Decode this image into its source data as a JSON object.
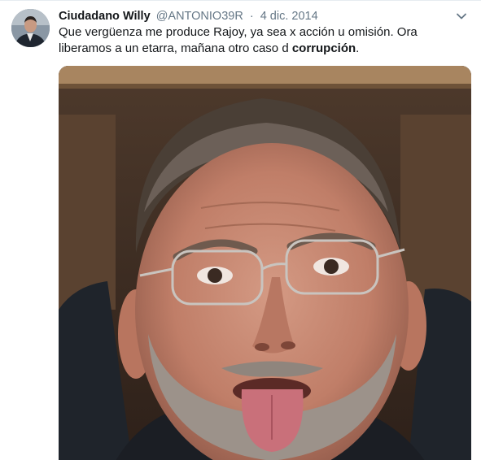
{
  "tweet": {
    "display_name": "Ciudadano Willy",
    "handle": "@ANTONIO39R",
    "separator": "·",
    "date": "4 dic. 2014",
    "text_main": "Que vergüenza me produce Rajoy, ya sea x acción u omisión. Ora liberamos a un etarra, mañana otro caso d ",
    "text_bold": "corrupción",
    "text_end": "."
  },
  "icons": {
    "menu": "chevron-down-icon",
    "avatar": "profile-photo",
    "media": "photo-man-sticking-out-tongue"
  },
  "colors": {
    "primary_text": "#14171a",
    "secondary_text": "#657786",
    "border": "#e6ecf0"
  }
}
